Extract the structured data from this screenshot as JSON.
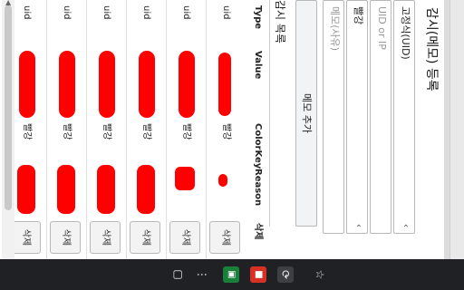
{
  "title": "감시(메모) 등록",
  "form": {
    "fixed_uid_label": "고정식(UID)",
    "uid_ip_placeholder": "UID or IP",
    "color_select_value": "빨강",
    "memo_placeholder": "메모(사유)",
    "add_button": "메모 추가",
    "chevron": "‹"
  },
  "list_title": "감시 목록",
  "table": {
    "headers": [
      "Type",
      "Value",
      "ColorKey",
      "Reason",
      "삭제"
    ],
    "rows": [
      {
        "type": "uid",
        "colorkey": "빨강",
        "delete": "삭제"
      },
      {
        "type": "uid",
        "colorkey": "빨강",
        "delete": "삭제"
      },
      {
        "type": "uid",
        "colorkey": "빨강",
        "delete": "삭제"
      },
      {
        "type": "uid",
        "colorkey": "빨강",
        "delete": "삭제"
      },
      {
        "type": "uid",
        "colorkey": "빨강",
        "delete": "삭제"
      },
      {
        "type": "uid",
        "colorkey": "빨강",
        "delete": "삭제"
      }
    ]
  },
  "colors": {
    "redaction": "#ff0000",
    "toolbar_bg": "#202124"
  },
  "icons": [
    "star-icon",
    "sync-icon",
    "extension-icon",
    "more-icon",
    "sidepanel-icon"
  ]
}
